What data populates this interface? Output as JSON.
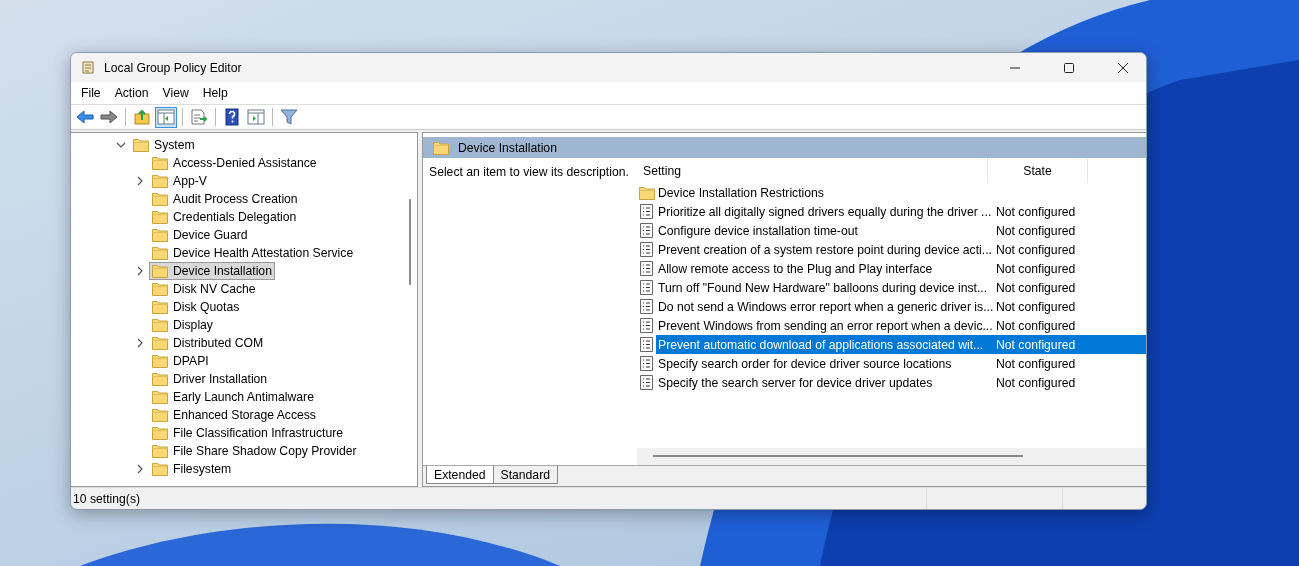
{
  "window": {
    "title": "Local Group Policy Editor"
  },
  "menu": [
    "File",
    "Action",
    "View",
    "Help"
  ],
  "toolbar": [
    {
      "kind": "back",
      "pressed": false
    },
    {
      "kind": "forward",
      "pressed": false
    },
    {
      "kind": "sep"
    },
    {
      "kind": "up",
      "pressed": false
    },
    {
      "kind": "tree",
      "pressed": true
    },
    {
      "kind": "sep"
    },
    {
      "kind": "export",
      "pressed": false
    },
    {
      "kind": "sep"
    },
    {
      "kind": "help",
      "pressed": false
    },
    {
      "kind": "view",
      "pressed": false
    },
    {
      "kind": "sep"
    },
    {
      "kind": "filter",
      "pressed": false
    }
  ],
  "tree": [
    {
      "label": "System",
      "expanded": true,
      "selected": false,
      "children": [
        {
          "label": "Access-Denied Assistance",
          "selected": false
        },
        {
          "label": "App-V",
          "expanded": false,
          "selected": false
        },
        {
          "label": "Audit Process Creation",
          "selected": false
        },
        {
          "label": "Credentials Delegation",
          "selected": false
        },
        {
          "label": "Device Guard",
          "selected": false
        },
        {
          "label": "Device Health Attestation Service",
          "selected": false
        },
        {
          "label": "Device Installation",
          "expanded": false,
          "selected": true
        },
        {
          "label": "Disk NV Cache",
          "selected": false
        },
        {
          "label": "Disk Quotas",
          "selected": false
        },
        {
          "label": "Display",
          "selected": false
        },
        {
          "label": "Distributed COM",
          "expanded": false,
          "selected": false
        },
        {
          "label": "DPAPI",
          "selected": false
        },
        {
          "label": "Driver Installation",
          "selected": false
        },
        {
          "label": "Early Launch Antimalware",
          "selected": false
        },
        {
          "label": "Enhanced Storage Access",
          "selected": false
        },
        {
          "label": "File Classification Infrastructure",
          "selected": false
        },
        {
          "label": "File Share Shadow Copy Provider",
          "selected": false
        },
        {
          "label": "Filesystem",
          "expanded": false,
          "selected": false
        }
      ]
    }
  ],
  "detail": {
    "title": "Device Installation",
    "description": "Select an item to view its description."
  },
  "table": {
    "columns": [
      "Setting",
      "State"
    ],
    "rows": [
      {
        "kind": "folder",
        "setting": "Device Installation Restrictions",
        "selected": false
      },
      {
        "kind": "policy",
        "setting": "Prioritize all digitally signed drivers equally during the driver ...",
        "state": "Not configured",
        "selected": false
      },
      {
        "kind": "policy",
        "setting": "Configure device installation time-out",
        "state": "Not configured",
        "selected": false
      },
      {
        "kind": "policy",
        "setting": "Prevent creation of a system restore point during device acti...",
        "state": "Not configured",
        "selected": false
      },
      {
        "kind": "policy",
        "setting": "Allow remote access to the Plug and Play interface",
        "state": "Not configured",
        "selected": false
      },
      {
        "kind": "policy",
        "setting": "Turn off \"Found New Hardware\" balloons during device inst...",
        "state": "Not configured",
        "selected": false
      },
      {
        "kind": "policy",
        "setting": "Do not send a Windows error report when a generic driver is...",
        "state": "Not configured",
        "selected": false
      },
      {
        "kind": "policy",
        "setting": "Prevent Windows from sending an error report when a devic...",
        "state": "Not configured",
        "selected": false
      },
      {
        "kind": "policy",
        "setting": "Prevent automatic download of applications associated wit...",
        "state": "Not configured",
        "selected": true
      },
      {
        "kind": "policy",
        "setting": "Specify search order for device driver source locations",
        "state": "Not configured",
        "selected": false
      },
      {
        "kind": "policy",
        "setting": "Specify the search server for device driver updates",
        "state": "Not configured",
        "selected": false
      }
    ]
  },
  "tabs": [
    {
      "label": "Extended",
      "selected": true
    },
    {
      "label": "Standard",
      "selected": false
    }
  ],
  "status_bar": "10 setting(s)"
}
